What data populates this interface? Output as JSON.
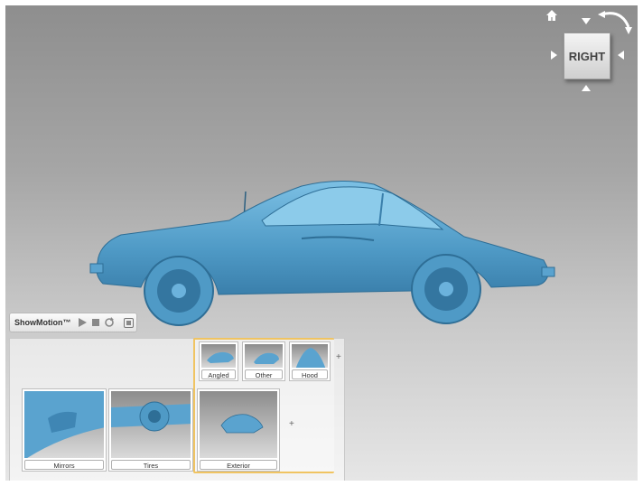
{
  "viewcube": {
    "face_label": "RIGHT",
    "icons": [
      "home-icon",
      "rotate-arrow-icon",
      "arrow-up-icon",
      "arrow-down-icon",
      "arrow-left-icon",
      "arrow-right-icon"
    ]
  },
  "showmotion": {
    "title": "ShowMotion™",
    "controls": [
      "play-icon",
      "stop-icon",
      "loop-icon",
      "close-icon"
    ],
    "sub_shots": [
      {
        "label": "Angled"
      },
      {
        "label": "Other"
      },
      {
        "label": "Hood"
      }
    ],
    "shots": [
      {
        "label": "Mirrors"
      },
      {
        "label": "Tires"
      },
      {
        "label": "Exterior"
      }
    ],
    "add_symbol": "+"
  },
  "colors": {
    "model_blue": "#5aa3cf",
    "highlight": "#f0c462"
  }
}
